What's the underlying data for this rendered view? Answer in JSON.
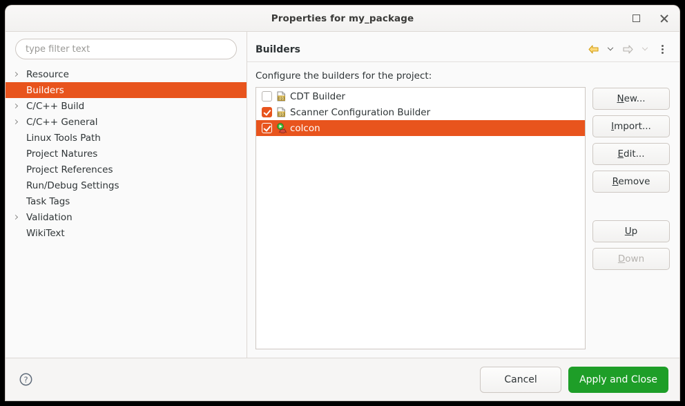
{
  "window": {
    "title": "Properties for my_package",
    "maximize_icon": "maximize-icon",
    "close_icon": "close-icon"
  },
  "sidebar": {
    "filter": {
      "placeholder": "type filter text",
      "value": ""
    },
    "items": [
      {
        "label": "Resource",
        "expandable": true,
        "selected": false
      },
      {
        "label": "Builders",
        "expandable": false,
        "selected": true
      },
      {
        "label": "C/C++ Build",
        "expandable": true,
        "selected": false
      },
      {
        "label": "C/C++ General",
        "expandable": true,
        "selected": false
      },
      {
        "label": "Linux Tools Path",
        "expandable": false,
        "selected": false
      },
      {
        "label": "Project Natures",
        "expandable": false,
        "selected": false
      },
      {
        "label": "Project References",
        "expandable": false,
        "selected": false
      },
      {
        "label": "Run/Debug Settings",
        "expandable": false,
        "selected": false
      },
      {
        "label": "Task Tags",
        "expandable": false,
        "selected": false
      },
      {
        "label": "Validation",
        "expandable": true,
        "selected": false
      },
      {
        "label": "WikiText",
        "expandable": false,
        "selected": false
      }
    ]
  },
  "content": {
    "title": "Builders",
    "description": "Configure the builders for the project:",
    "tools": [
      {
        "name": "back-arrow-icon",
        "enabled": true
      },
      {
        "name": "back-history-dropdown-icon",
        "enabled": true
      },
      {
        "name": "forward-arrow-icon",
        "enabled": false
      },
      {
        "name": "forward-history-dropdown-icon",
        "enabled": false
      },
      {
        "name": "view-menu-kebab-icon",
        "enabled": true
      }
    ],
    "builders": [
      {
        "label": "CDT Builder",
        "checked": false,
        "selected": false,
        "icon": "binary-document-icon"
      },
      {
        "label": "Scanner Configuration Builder",
        "checked": true,
        "selected": false,
        "icon": "binary-document-icon"
      },
      {
        "label": "colcon",
        "checked": true,
        "selected": true,
        "icon": "ant-run-icon"
      }
    ],
    "buttons": [
      {
        "label": "New...",
        "mnemonic": "N",
        "enabled": true
      },
      {
        "label": "Import...",
        "mnemonic": "I",
        "enabled": true
      },
      {
        "label": "Edit...",
        "mnemonic": "E",
        "enabled": true
      },
      {
        "label": "Remove",
        "mnemonic": "R",
        "enabled": true
      },
      {
        "label": "Up",
        "mnemonic": "U",
        "enabled": true
      },
      {
        "label": "Down",
        "mnemonic": "D",
        "enabled": false
      }
    ]
  },
  "footer": {
    "help_icon": "help-question-icon",
    "cancel_label": "Cancel",
    "apply_close_label": "Apply and Close"
  },
  "colors": {
    "accent_orange": "#e8541d",
    "apply_green": "#1e9e28",
    "window_bg": "#f6f5f4",
    "panel_bg": "#fafafa",
    "border": "#cdc7c2",
    "text": "#2e3436",
    "disabled_text": "#b5b2ae"
  }
}
